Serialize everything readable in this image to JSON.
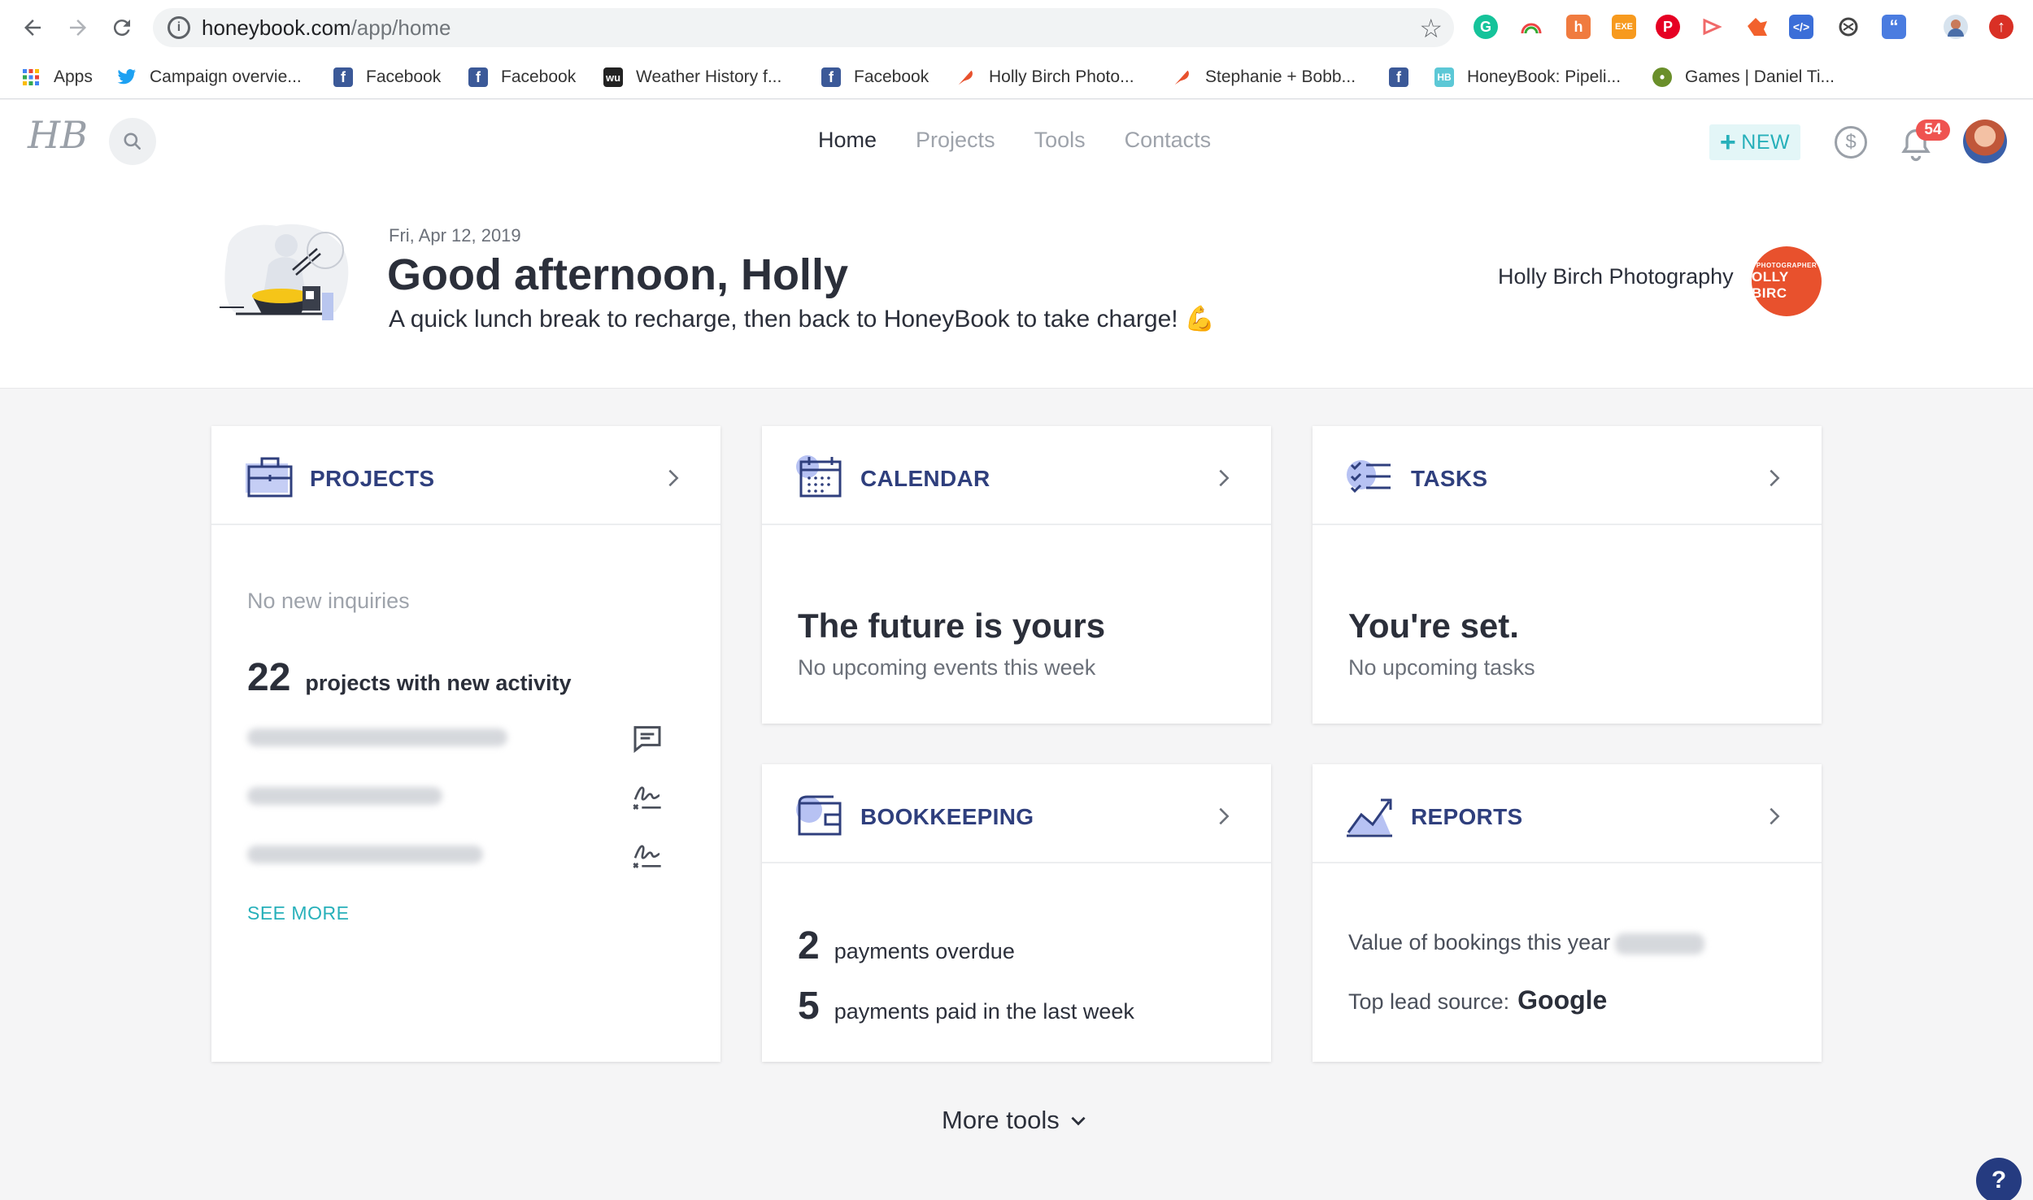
{
  "browser": {
    "url_host": "honeybook.com",
    "url_path": "/app/home",
    "bookmarks": [
      {
        "label": "Apps",
        "icon": "apps-grid-icon",
        "color": "#4285f4"
      },
      {
        "label": "Campaign overvie...",
        "icon": "twitter-icon",
        "color": "#1da1f2"
      },
      {
        "label": "Facebook",
        "icon": "facebook-icon",
        "color": "#3b5998"
      },
      {
        "label": "Facebook",
        "icon": "facebook-icon",
        "color": "#3b5998"
      },
      {
        "label": "Weather History f...",
        "icon": "weather-underground-icon",
        "color": "#222222"
      },
      {
        "label": "Facebook",
        "icon": "facebook-icon",
        "color": "#3b5998"
      },
      {
        "label": "Holly Birch Photo...",
        "icon": "feather-icon",
        "color": "#e8512d"
      },
      {
        "label": "Stephanie + Bobb...",
        "icon": "feather-icon",
        "color": "#e8512d"
      },
      {
        "label": "",
        "icon": "facebook-icon",
        "color": "#3b5998"
      },
      {
        "label": "HoneyBook: Pipeli...",
        "icon": "honeybook-icon",
        "color": "#5cc8d6"
      },
      {
        "label": "Games | Daniel Ti...",
        "icon": "tiger-icon",
        "color": "#6a8f2a"
      }
    ]
  },
  "app": {
    "logo": "HB",
    "nav": [
      "Home",
      "Projects",
      "Tools",
      "Contacts"
    ],
    "nav_active": "Home",
    "new_label": "NEW",
    "notification_count": "54",
    "accent": "#27b0ba",
    "brand": "#2f3f7d"
  },
  "greeting": {
    "date": "Fri, Apr 12, 2019",
    "title": "Good afternoon, Holly",
    "subtitle": "A quick lunch break to recharge, then back to HoneyBook to take charge! 💪",
    "company_name": "Holly Birch Photography",
    "company_logo_top": "PHOTOGRAPHER",
    "company_logo_main": "OLLY BIRC"
  },
  "cards": {
    "projects": {
      "title": "PROJECTS",
      "inquiries": "No new inquiries",
      "count": "22",
      "count_label": "projects with new activity",
      "see_more": "SEE MORE"
    },
    "calendar": {
      "title": "CALENDAR",
      "headline": "The future is yours",
      "sub": "No upcoming events this week"
    },
    "tasks": {
      "title": "TASKS",
      "headline": "You're set.",
      "sub": "No upcoming tasks"
    },
    "bookkeeping": {
      "title": "BOOKKEEPING",
      "overdue_count": "2",
      "overdue_label": "payments overdue",
      "paid_count": "5",
      "paid_label": "payments paid in the last week"
    },
    "reports": {
      "title": "REPORTS",
      "bookings_label": "Value of bookings this year",
      "lead_label": "Top lead source:",
      "lead_value": "Google"
    }
  },
  "footer": {
    "more_tools": "More tools",
    "help": "?"
  }
}
